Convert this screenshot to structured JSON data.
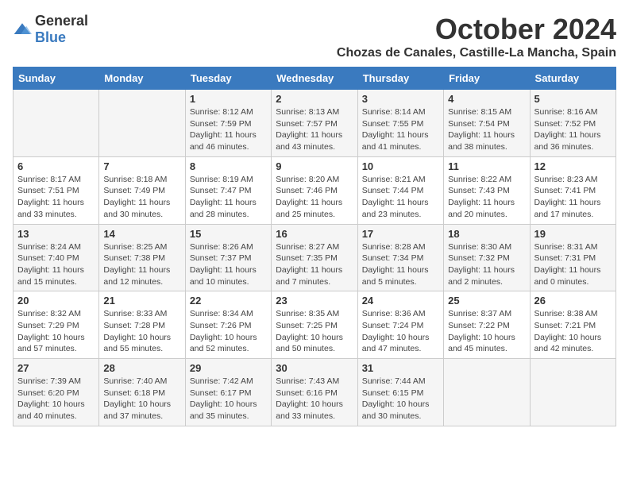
{
  "header": {
    "logo_general": "General",
    "logo_blue": "Blue",
    "month_title": "October 2024",
    "location": "Chozas de Canales, Castille-La Mancha, Spain"
  },
  "weekdays": [
    "Sunday",
    "Monday",
    "Tuesday",
    "Wednesday",
    "Thursday",
    "Friday",
    "Saturday"
  ],
  "weeks": [
    [
      {
        "day": "",
        "detail": ""
      },
      {
        "day": "",
        "detail": ""
      },
      {
        "day": "1",
        "detail": "Sunrise: 8:12 AM\nSunset: 7:59 PM\nDaylight: 11 hours and 46 minutes."
      },
      {
        "day": "2",
        "detail": "Sunrise: 8:13 AM\nSunset: 7:57 PM\nDaylight: 11 hours and 43 minutes."
      },
      {
        "day": "3",
        "detail": "Sunrise: 8:14 AM\nSunset: 7:55 PM\nDaylight: 11 hours and 41 minutes."
      },
      {
        "day": "4",
        "detail": "Sunrise: 8:15 AM\nSunset: 7:54 PM\nDaylight: 11 hours and 38 minutes."
      },
      {
        "day": "5",
        "detail": "Sunrise: 8:16 AM\nSunset: 7:52 PM\nDaylight: 11 hours and 36 minutes."
      }
    ],
    [
      {
        "day": "6",
        "detail": "Sunrise: 8:17 AM\nSunset: 7:51 PM\nDaylight: 11 hours and 33 minutes."
      },
      {
        "day": "7",
        "detail": "Sunrise: 8:18 AM\nSunset: 7:49 PM\nDaylight: 11 hours and 30 minutes."
      },
      {
        "day": "8",
        "detail": "Sunrise: 8:19 AM\nSunset: 7:47 PM\nDaylight: 11 hours and 28 minutes."
      },
      {
        "day": "9",
        "detail": "Sunrise: 8:20 AM\nSunset: 7:46 PM\nDaylight: 11 hours and 25 minutes."
      },
      {
        "day": "10",
        "detail": "Sunrise: 8:21 AM\nSunset: 7:44 PM\nDaylight: 11 hours and 23 minutes."
      },
      {
        "day": "11",
        "detail": "Sunrise: 8:22 AM\nSunset: 7:43 PM\nDaylight: 11 hours and 20 minutes."
      },
      {
        "day": "12",
        "detail": "Sunrise: 8:23 AM\nSunset: 7:41 PM\nDaylight: 11 hours and 17 minutes."
      }
    ],
    [
      {
        "day": "13",
        "detail": "Sunrise: 8:24 AM\nSunset: 7:40 PM\nDaylight: 11 hours and 15 minutes."
      },
      {
        "day": "14",
        "detail": "Sunrise: 8:25 AM\nSunset: 7:38 PM\nDaylight: 11 hours and 12 minutes."
      },
      {
        "day": "15",
        "detail": "Sunrise: 8:26 AM\nSunset: 7:37 PM\nDaylight: 11 hours and 10 minutes."
      },
      {
        "day": "16",
        "detail": "Sunrise: 8:27 AM\nSunset: 7:35 PM\nDaylight: 11 hours and 7 minutes."
      },
      {
        "day": "17",
        "detail": "Sunrise: 8:28 AM\nSunset: 7:34 PM\nDaylight: 11 hours and 5 minutes."
      },
      {
        "day": "18",
        "detail": "Sunrise: 8:30 AM\nSunset: 7:32 PM\nDaylight: 11 hours and 2 minutes."
      },
      {
        "day": "19",
        "detail": "Sunrise: 8:31 AM\nSunset: 7:31 PM\nDaylight: 11 hours and 0 minutes."
      }
    ],
    [
      {
        "day": "20",
        "detail": "Sunrise: 8:32 AM\nSunset: 7:29 PM\nDaylight: 10 hours and 57 minutes."
      },
      {
        "day": "21",
        "detail": "Sunrise: 8:33 AM\nSunset: 7:28 PM\nDaylight: 10 hours and 55 minutes."
      },
      {
        "day": "22",
        "detail": "Sunrise: 8:34 AM\nSunset: 7:26 PM\nDaylight: 10 hours and 52 minutes."
      },
      {
        "day": "23",
        "detail": "Sunrise: 8:35 AM\nSunset: 7:25 PM\nDaylight: 10 hours and 50 minutes."
      },
      {
        "day": "24",
        "detail": "Sunrise: 8:36 AM\nSunset: 7:24 PM\nDaylight: 10 hours and 47 minutes."
      },
      {
        "day": "25",
        "detail": "Sunrise: 8:37 AM\nSunset: 7:22 PM\nDaylight: 10 hours and 45 minutes."
      },
      {
        "day": "26",
        "detail": "Sunrise: 8:38 AM\nSunset: 7:21 PM\nDaylight: 10 hours and 42 minutes."
      }
    ],
    [
      {
        "day": "27",
        "detail": "Sunrise: 7:39 AM\nSunset: 6:20 PM\nDaylight: 10 hours and 40 minutes."
      },
      {
        "day": "28",
        "detail": "Sunrise: 7:40 AM\nSunset: 6:18 PM\nDaylight: 10 hours and 37 minutes."
      },
      {
        "day": "29",
        "detail": "Sunrise: 7:42 AM\nSunset: 6:17 PM\nDaylight: 10 hours and 35 minutes."
      },
      {
        "day": "30",
        "detail": "Sunrise: 7:43 AM\nSunset: 6:16 PM\nDaylight: 10 hours and 33 minutes."
      },
      {
        "day": "31",
        "detail": "Sunrise: 7:44 AM\nSunset: 6:15 PM\nDaylight: 10 hours and 30 minutes."
      },
      {
        "day": "",
        "detail": ""
      },
      {
        "day": "",
        "detail": ""
      }
    ]
  ]
}
